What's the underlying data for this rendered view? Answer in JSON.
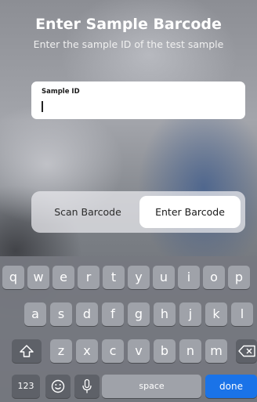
{
  "header": {
    "title": "Enter Sample Barcode",
    "subtitle": "Enter the sample ID of the test sample"
  },
  "sample_id_field": {
    "label": "Sample ID",
    "value": ""
  },
  "mode_toggle": {
    "scan_label": "Scan Barcode",
    "enter_label": "Enter Barcode",
    "selected": "Enter Barcode"
  },
  "keyboard": {
    "row1": [
      "q",
      "w",
      "e",
      "r",
      "t",
      "y",
      "u",
      "i",
      "o",
      "p"
    ],
    "row2": [
      "a",
      "s",
      "d",
      "f",
      "g",
      "h",
      "j",
      "k",
      "l"
    ],
    "row3": [
      "z",
      "x",
      "c",
      "v",
      "b",
      "n",
      "m"
    ],
    "numbers_label": "123",
    "space_label": "space",
    "done_label": "done",
    "shift_icon": "shift-arrow-icon",
    "delete_icon": "backspace-icon",
    "emoji_icon": "emoji-face-icon",
    "mic_icon": "microphone-icon",
    "done_color": "#1a73e8"
  }
}
